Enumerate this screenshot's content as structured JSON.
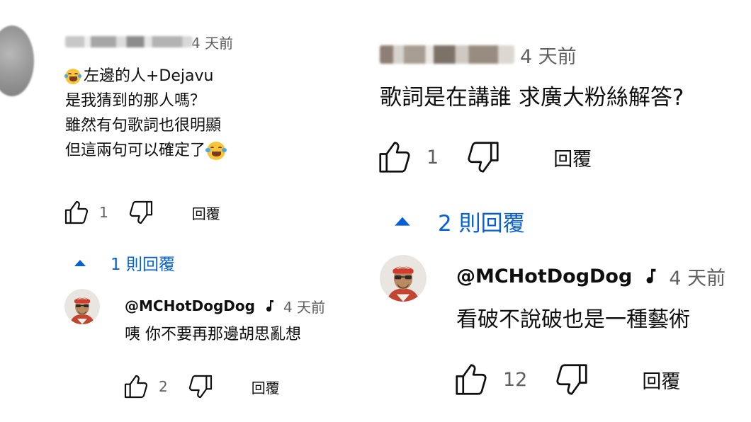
{
  "left": {
    "comment": {
      "time": "4 天前",
      "lines": [
        "左邊的人+Dejavu",
        "是我猜到的那人嗎？",
        "雖然有句歌詞也很明顯",
        "但這兩句可以確定了"
      ],
      "likes": "1",
      "reply_label": "回覆"
    },
    "replies_toggle": "1 則回覆",
    "reply": {
      "author": "@MCHotDogDog",
      "time": "4 天前",
      "text": "咦 你不要再那邊胡思亂想",
      "likes": "2",
      "reply_label": "回覆"
    }
  },
  "right": {
    "comment": {
      "time": "4 天前",
      "text": "歌詞是在講誰 求廣大粉絲解答?",
      "likes": "1",
      "reply_label": "回覆"
    },
    "replies_toggle": "2 則回覆",
    "reply": {
      "author": "@MCHotDogDog",
      "time": "4 天前",
      "text": "看破不說破也是一種藝術",
      "likes": "12",
      "reply_label": "回覆"
    }
  },
  "colors": {
    "link_blue": "#065fd4",
    "muted": "#606060"
  },
  "icons": [
    "thumb-up-icon",
    "thumb-down-icon",
    "caret-up-icon",
    "music-note-icon",
    "laughing-emoji-icon"
  ]
}
